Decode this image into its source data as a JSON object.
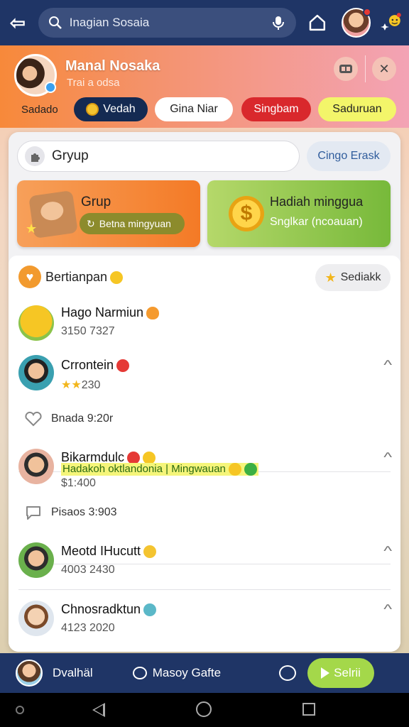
{
  "topbar": {
    "search_placeholder": "Inagian Sosaia"
  },
  "profile": {
    "name": "Manal Nosaka",
    "subtitle": "Trai a odsa",
    "filter_label": "Sadado",
    "chips": [
      "Vedah",
      "Gina Niar",
      "Singbam",
      "Saduruan"
    ]
  },
  "groups": {
    "search_value": "Gryup",
    "button": "Cingo Erask",
    "card_left": {
      "title": "Grup",
      "pill": "Betna mingyuan"
    },
    "card_right": {
      "title": "Hadiah minggua",
      "subtitle": "Snglkar (ncoauan)"
    }
  },
  "list": {
    "header": "Bertianpan",
    "header_button": "Sediakk",
    "items": [
      {
        "name": "Hago Narmiun",
        "sub": "3150 7327"
      },
      {
        "name": "Crrontein",
        "sub": "230",
        "action": "Bnada 9:20r"
      },
      {
        "name": "Bikarmdulc",
        "highlight": "Hadakoh oktlandonia",
        "highlight_tail": "Mingwauan",
        "sub": "$1:400",
        "action": "Pisaos 3:903"
      },
      {
        "name": "Meotd IHucutt",
        "sub": "4003 2430"
      },
      {
        "name": "Chnosradktun",
        "sub": "4123 2020"
      }
    ]
  },
  "bottombar": {
    "name": "Dvalhäl",
    "chat": "Masoy Gafte",
    "send": "Selrii"
  },
  "colors": {
    "topbar": "#1f3566",
    "accent_orange": "#f47a26",
    "accent_green": "#a4d84a",
    "chip_red": "#d9282c",
    "chip_yellow": "#f3f56a"
  }
}
